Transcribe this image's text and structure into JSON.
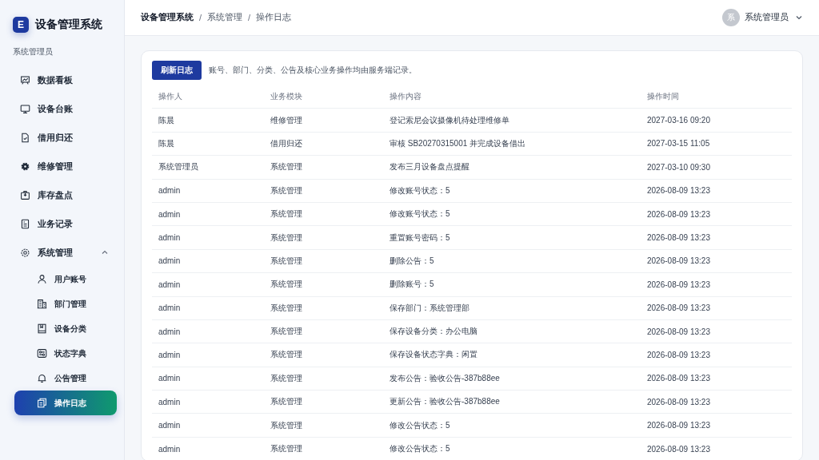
{
  "brand": {
    "logo": "E",
    "title": "设备管理系统"
  },
  "sidebar": {
    "role": "系统管理员",
    "items": [
      {
        "label": "数据看板",
        "selected": false
      },
      {
        "label": "设备台账",
        "selected": false
      },
      {
        "label": "借用归还",
        "selected": false
      },
      {
        "label": "维修管理",
        "selected": false
      },
      {
        "label": "库存盘点",
        "selected": false
      },
      {
        "label": "业务记录",
        "selected": false
      },
      {
        "label": "系统管理",
        "selected": false,
        "expanded": true,
        "children": [
          {
            "label": "用户账号",
            "selected": false
          },
          {
            "label": "部门管理",
            "selected": false
          },
          {
            "label": "设备分类",
            "selected": false
          },
          {
            "label": "状态字典",
            "selected": false
          },
          {
            "label": "公告管理",
            "selected": false
          },
          {
            "label": "操作日志",
            "selected": true
          }
        ]
      }
    ]
  },
  "breadcrumb": {
    "separator": "/",
    "items": [
      "设备管理系统",
      "系统管理",
      "操作日志"
    ]
  },
  "user": {
    "avatar": "系",
    "name": "系统管理员"
  },
  "toolbar": {
    "button": "刷新日志",
    "note": "账号、部门、分类、公告及核心业务操作均由服务端记录。"
  },
  "table": {
    "columns": [
      "操作人",
      "业务模块",
      "操作内容",
      "操作时间"
    ],
    "rows": [
      [
        "陈晨",
        "维修管理",
        "登记索尼会议摄像机待处理维修单",
        "2027-03-16 09:20"
      ],
      [
        "陈晨",
        "借用归还",
        "审核 SB20270315001 并完成设备借出",
        "2027-03-15 11:05"
      ],
      [
        "系统管理员",
        "系统管理",
        "发布三月设备盘点提醒",
        "2027-03-10 09:30"
      ],
      [
        "admin",
        "系统管理",
        "修改账号状态：5",
        "2026-08-09 13:23"
      ],
      [
        "admin",
        "系统管理",
        "修改账号状态：5",
        "2026-08-09 13:23"
      ],
      [
        "admin",
        "系统管理",
        "重置账号密码：5",
        "2026-08-09 13:23"
      ],
      [
        "admin",
        "系统管理",
        "删除公告：5",
        "2026-08-09 13:23"
      ],
      [
        "admin",
        "系统管理",
        "删除账号：5",
        "2026-08-09 13:23"
      ],
      [
        "admin",
        "系统管理",
        "保存部门：系统管理部",
        "2026-08-09 13:23"
      ],
      [
        "admin",
        "系统管理",
        "保存设备分类：办公电脑",
        "2026-08-09 13:23"
      ],
      [
        "admin",
        "系统管理",
        "保存设备状态字典：闲置",
        "2026-08-09 13:23"
      ],
      [
        "admin",
        "系统管理",
        "发布公告：验收公告-387b88ee",
        "2026-08-09 13:23"
      ],
      [
        "admin",
        "系统管理",
        "更新公告：验收公告-387b88ee",
        "2026-08-09 13:23"
      ],
      [
        "admin",
        "系统管理",
        "修改公告状态：5",
        "2026-08-09 13:23"
      ],
      [
        "admin",
        "系统管理",
        "修改公告状态：5",
        "2026-08-09 13:23"
      ]
    ]
  }
}
